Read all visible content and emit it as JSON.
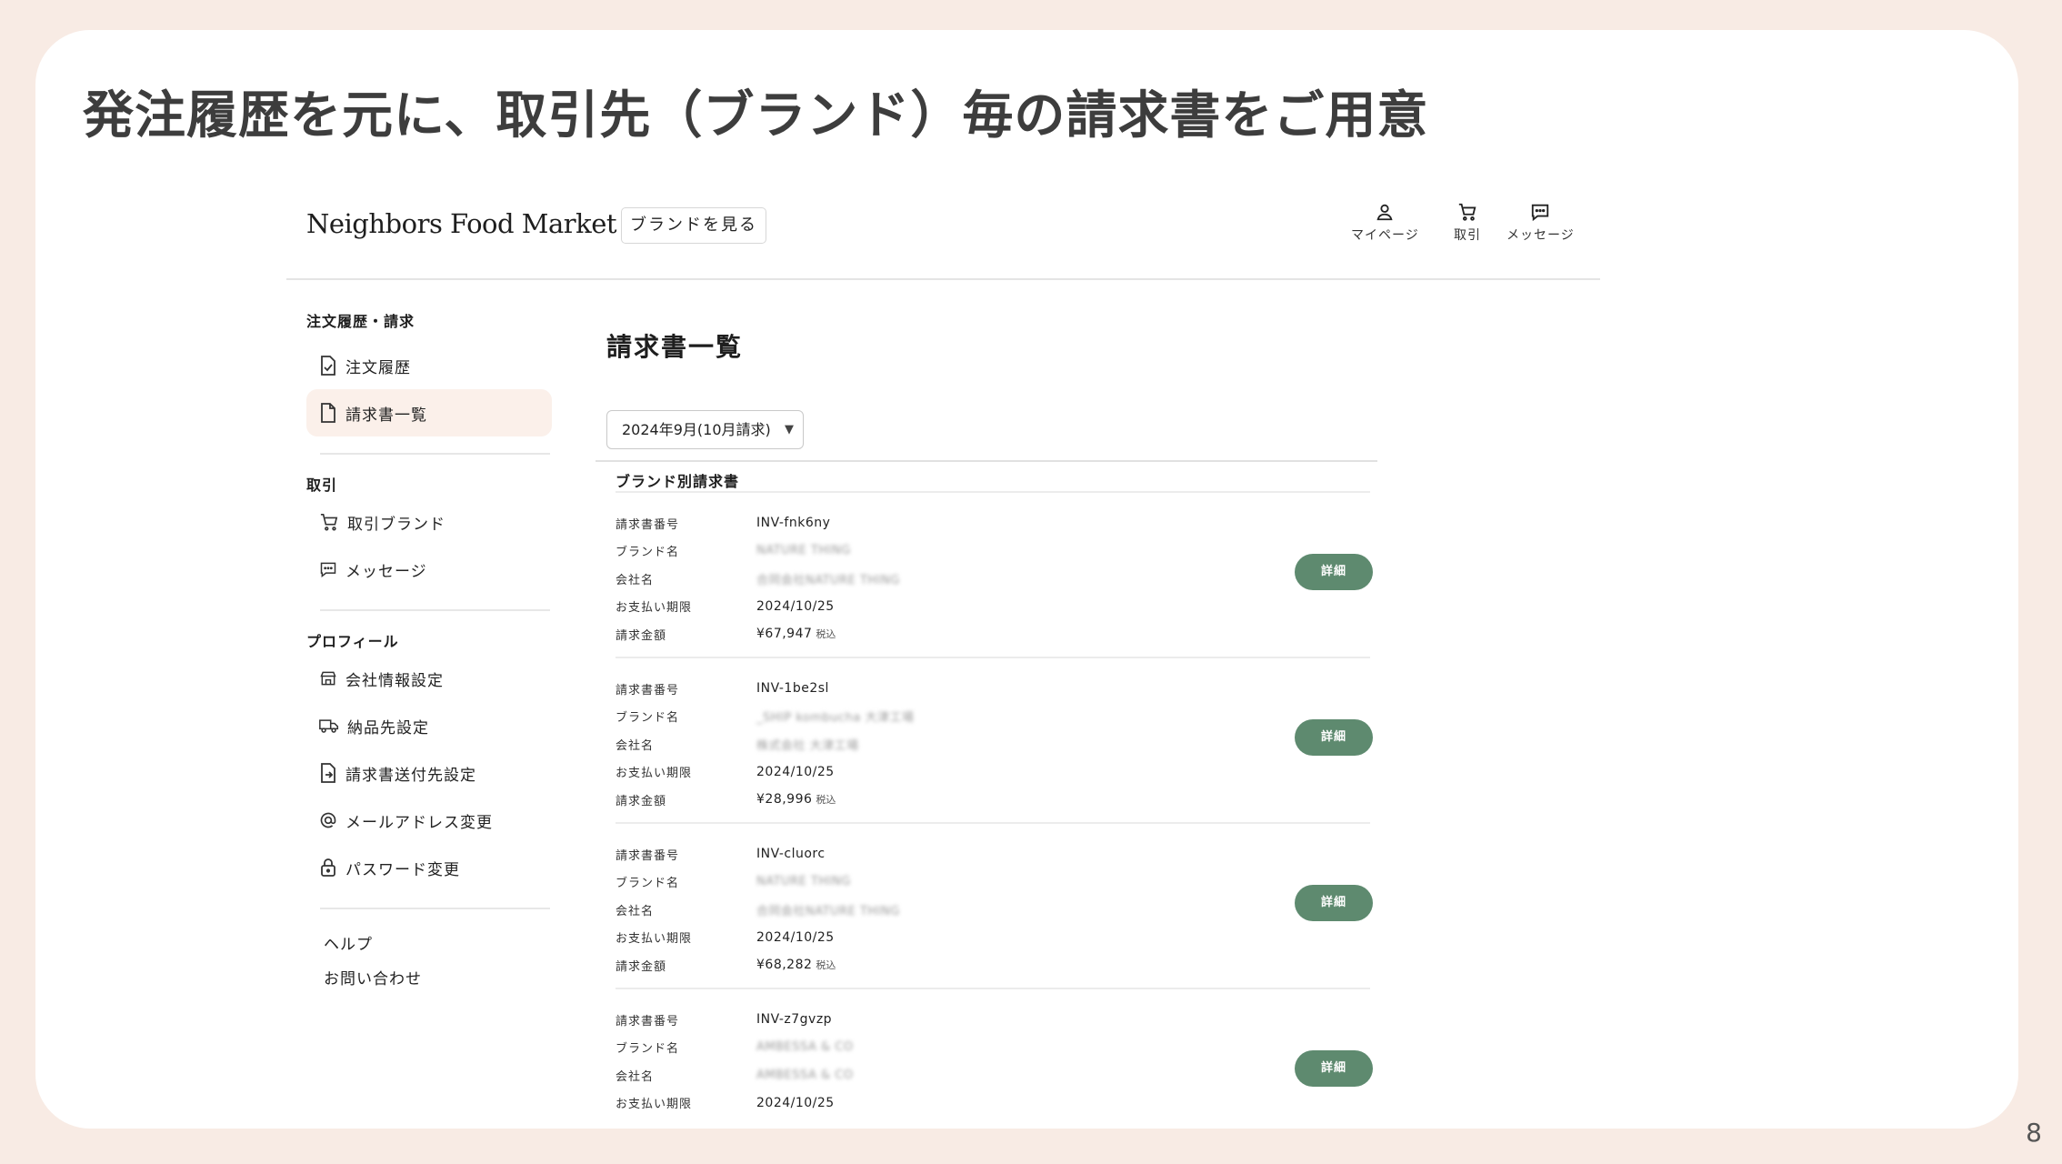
{
  "slide": {
    "title": "発注履歴を元に、取引先（ブランド）毎の請求書をご用意",
    "page_number": "8"
  },
  "header": {
    "logo": "Neighbors Food Market",
    "brands_button": "ブランドを見る",
    "nav": [
      {
        "label": "マイページ",
        "icon": "user-icon"
      },
      {
        "label": "取引",
        "icon": "cart-icon"
      },
      {
        "label": "メッセージ",
        "icon": "message-icon"
      }
    ]
  },
  "sidebar": {
    "sections": [
      {
        "title": "注文履歴・請求",
        "items": [
          {
            "label": "注文履歴",
            "icon": "file-check-icon",
            "active": false
          },
          {
            "label": "請求書一覧",
            "icon": "file-icon",
            "active": true
          }
        ]
      },
      {
        "title": "取引",
        "items": [
          {
            "label": "取引ブランド",
            "icon": "cart-icon",
            "active": false
          },
          {
            "label": "メッセージ",
            "icon": "message-icon",
            "active": false
          }
        ]
      },
      {
        "title": "プロフィール",
        "items": [
          {
            "label": "会社情報設定",
            "icon": "store-icon",
            "active": false
          },
          {
            "label": "納品先設定",
            "icon": "truck-icon",
            "active": false
          },
          {
            "label": "請求書送付先設定",
            "icon": "file-send-icon",
            "active": false
          },
          {
            "label": "メールアドレス変更",
            "icon": "at-sign-icon",
            "active": false
          },
          {
            "label": "パスワード変更",
            "icon": "lock-icon",
            "active": false
          }
        ]
      }
    ],
    "help_links": [
      "ヘルプ",
      "お問い合わせ"
    ]
  },
  "main": {
    "title": "請求書一覧",
    "period_select": {
      "value": "2024年9月(10月請求)"
    },
    "section_label": "ブランド別請求書",
    "labels": {
      "invoice_number": "請求書番号",
      "brand_name": "ブランド名",
      "company_name": "会社名",
      "due_date": "お支払い期限",
      "amount": "請求金額",
      "tax_included": "税込",
      "detail_button": "詳細"
    },
    "invoices": [
      {
        "invoice_number": "INV-fnk6ny",
        "brand_name": "NATURE THING",
        "company_name": "合同会社NATURE THING",
        "due_date": "2024/10/25",
        "amount": "¥67,947"
      },
      {
        "invoice_number": "INV-1be2sl",
        "brand_name": "_SHIP kombucha 大津工場",
        "company_name": "株式会社 大津工場",
        "due_date": "2024/10/25",
        "amount": "¥28,996"
      },
      {
        "invoice_number": "INV-cluorc",
        "brand_name": "NATURE THING",
        "company_name": "合同会社NATURE THING",
        "due_date": "2024/10/25",
        "amount": "¥68,282"
      },
      {
        "invoice_number": "INV-z7gvzp",
        "brand_name": "AMBESSA & CO",
        "company_name": "AMBESSA & CO",
        "due_date": "2024/10/25",
        "amount": ""
      }
    ]
  },
  "colors": {
    "background": "#f8ebe4",
    "accent_green": "#5e8a6f",
    "active_item_bg": "#fbf0ea"
  }
}
